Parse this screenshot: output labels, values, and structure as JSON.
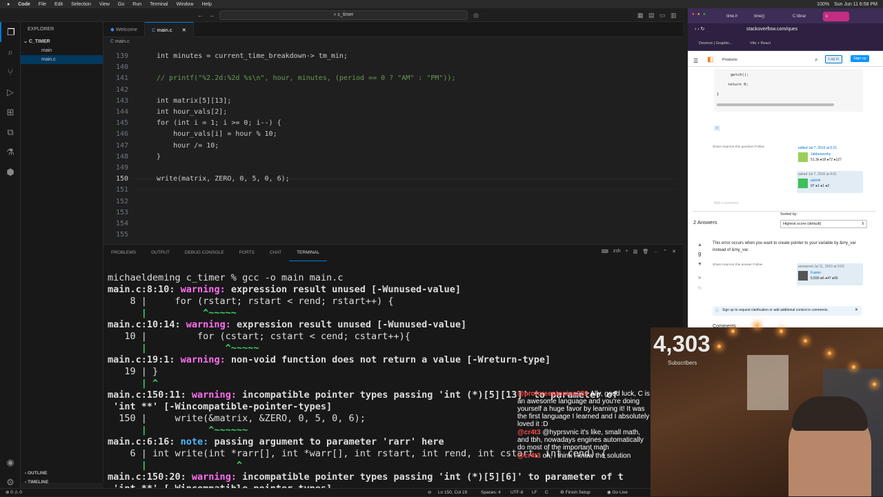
{
  "menubar": {
    "apple": "",
    "app": "Code",
    "items": [
      "File",
      "Edit",
      "Selection",
      "View",
      "Go",
      "Run",
      "Terminal",
      "Window",
      "Help"
    ],
    "clock": "Sun Jun 11 6:58 PM",
    "battery": "100%"
  },
  "titlebar": {
    "search": "c_timer"
  },
  "explorer": {
    "title": "EXPLORER",
    "folder": "C_TIMER",
    "files": [
      "main",
      "main.c"
    ],
    "outline": "OUTLINE",
    "timeline": "TIMELINE"
  },
  "tabs": [
    "Welcome",
    "main.c"
  ],
  "breadcrumb": "main.c",
  "editor": {
    "lines": [
      {
        "n": "139",
        "t": "int minutes = current_time_breakdown-> tm_min;"
      },
      {
        "n": "140",
        "t": ""
      },
      {
        "n": "141",
        "t": "// printf(\"%2.2d:%2d %s\\n\", hour, minutes, (period == 0 ? \"AM\" : \"PM\"));"
      },
      {
        "n": "142",
        "t": ""
      },
      {
        "n": "143",
        "t": "int matrix[5][13];"
      },
      {
        "n": "144",
        "t": "int hour_vals[2];"
      },
      {
        "n": "145",
        "t": "for (int i = 1; i >= 0; i--) {"
      },
      {
        "n": "146",
        "t": "    hour_vals[i] = hour % 10;"
      },
      {
        "n": "147",
        "t": "    hour /= 10;"
      },
      {
        "n": "148",
        "t": "}"
      },
      {
        "n": "149",
        "t": ""
      },
      {
        "n": "150",
        "t": "write(matrix, ZERO, 0, 5, 0, 6);"
      },
      {
        "n": "151",
        "t": ""
      },
      {
        "n": "152",
        "t": ""
      },
      {
        "n": "153",
        "t": ""
      },
      {
        "n": "154",
        "t": ""
      },
      {
        "n": "155",
        "t": ""
      }
    ]
  },
  "panel": {
    "tabs": [
      "PROBLEMS",
      "OUTPUT",
      "DEBUG CONSOLE",
      "PORTS",
      "CHAT",
      "TERMINAL"
    ],
    "shell": "zsh"
  },
  "terminal": [
    [
      "",
      "michaeldeming c_timer % gcc -o main main.c"
    ],
    [
      "w",
      "main.c:8:10:",
      "warning:",
      "expression result unused [-Wunused-value]"
    ],
    [
      "",
      "    8 |     for (rstart; rstart < rend; rstart++) {"
    ],
    [
      "g",
      "      |          ^~~~~~"
    ],
    [
      "w",
      "main.c:10:14:",
      "warning:",
      "expression result unused [-Wunused-value]"
    ],
    [
      "",
      "   10 |         for (cstart; cstart < cend; cstart++){"
    ],
    [
      "g",
      "      |              ^~~~~~"
    ],
    [
      "w",
      "main.c:19:1:",
      "warning:",
      "non-void function does not return a value [-Wreturn-type]"
    ],
    [
      "",
      "   19 | }"
    ],
    [
      "g",
      "      | ^"
    ],
    [
      "w",
      "main.c:150:11:",
      "warning:",
      "incompatible pointer types passing 'int (*)[5][13]' to parameter of"
    ],
    [
      "bd",
      " 'int **' [-Wincompatible-pointer-types]"
    ],
    [
      "",
      "  150 |     write(&matrix, &ZERO, 0, 5, 0, 6);"
    ],
    [
      "g",
      "      |           ^~~~~~~"
    ],
    [
      "n",
      "main.c:6:16:",
      "note:",
      "passing argument to parameter 'rarr' here"
    ],
    [
      "",
      "    6 | int write(int *rarr[], int *warr[], int rstart, int rend, int cstart, int cend) {"
    ],
    [
      "g",
      "      |                ^"
    ],
    [
      "w",
      "main.c:150:20:",
      "warning:",
      "incompatible pointer types passing 'int (*)[5][6]' to parameter of t"
    ],
    [
      "bd",
      " 'int **' [-Wincompatible-pointer-types]"
    ]
  ],
  "statusbar": {
    "left": "⊗ 0 ⚠ 0",
    "pos": "Ln 150, Col 19",
    "spaces": "Spaces: 4",
    "enc": "UTF-8",
    "eol": "LF",
    "lang": "C",
    "finish": "Finish Setup",
    "golive": "Go Live"
  },
  "browser": {
    "tabs": [
      "time.h",
      "time()",
      "C librar",
      "c"
    ],
    "url": "stackoverflow.com/ques",
    "bookmarks": [
      "Desmos | Graphin...",
      "Vite + React"
    ],
    "header": {
      "products": "Products",
      "login": "Log in",
      "signup": "Sign up"
    },
    "code": [
      "getch();",
      "return 0;",
      "}"
    ],
    "tag": "c",
    "qactions": "Share   Improve this question   Follow",
    "edited": "edited Jul 7, 2016 at 5:21",
    "editor_name": "Jabberwocky",
    "editor_rep": "51.3k ●18 ●72 ●127",
    "asked": "asked Jul 7, 2016 at 4:01",
    "asker_name": "azizoh",
    "asker_rep": "97 ●1 ●1 ●2",
    "add_comment": "Add a comment",
    "answers_count": "2 Answers",
    "sorted_label": "Sorted by:",
    "sorted_value": "Highest score (default)",
    "vote": "9",
    "answer_text": "This error occurs when you want to create pointer to your variable by &my_var instead of &my_var.",
    "aactions": "Share   Improve this answer   Follow",
    "answered": "answered Jul 11, 2019 at 9:03",
    "answerer_name": "Fusion",
    "answerer_rep": "5,590 ●6 ●47 ●56",
    "notice": "Sign up to request clarification or add additional context in comments.",
    "comments": "Comments"
  },
  "stream": {
    "subs_count": "4,303",
    "subs_label": "Subscribers",
    "chat": [
      {
        "user": "@profcreeptonius223",
        "msg": "Ally, good luck, C is an awesome language and you're doing yourself a huge favor by learning it! It was the first language I learned and I absolutely loved it :D"
      },
      {
        "user": "@cr4t3",
        "msg": "@hyprsvnic it's like, small math, and tbh, nowadays engines automatically do most of the important math"
      },
      {
        "user": "@cr4t3",
        "msg": "oh, i think i know the solution"
      }
    ]
  },
  "colors": {
    "warning": "#ff6ef0",
    "note": "#4fb8ff",
    "caret": "#38d46a",
    "accent": "#0078d4"
  }
}
